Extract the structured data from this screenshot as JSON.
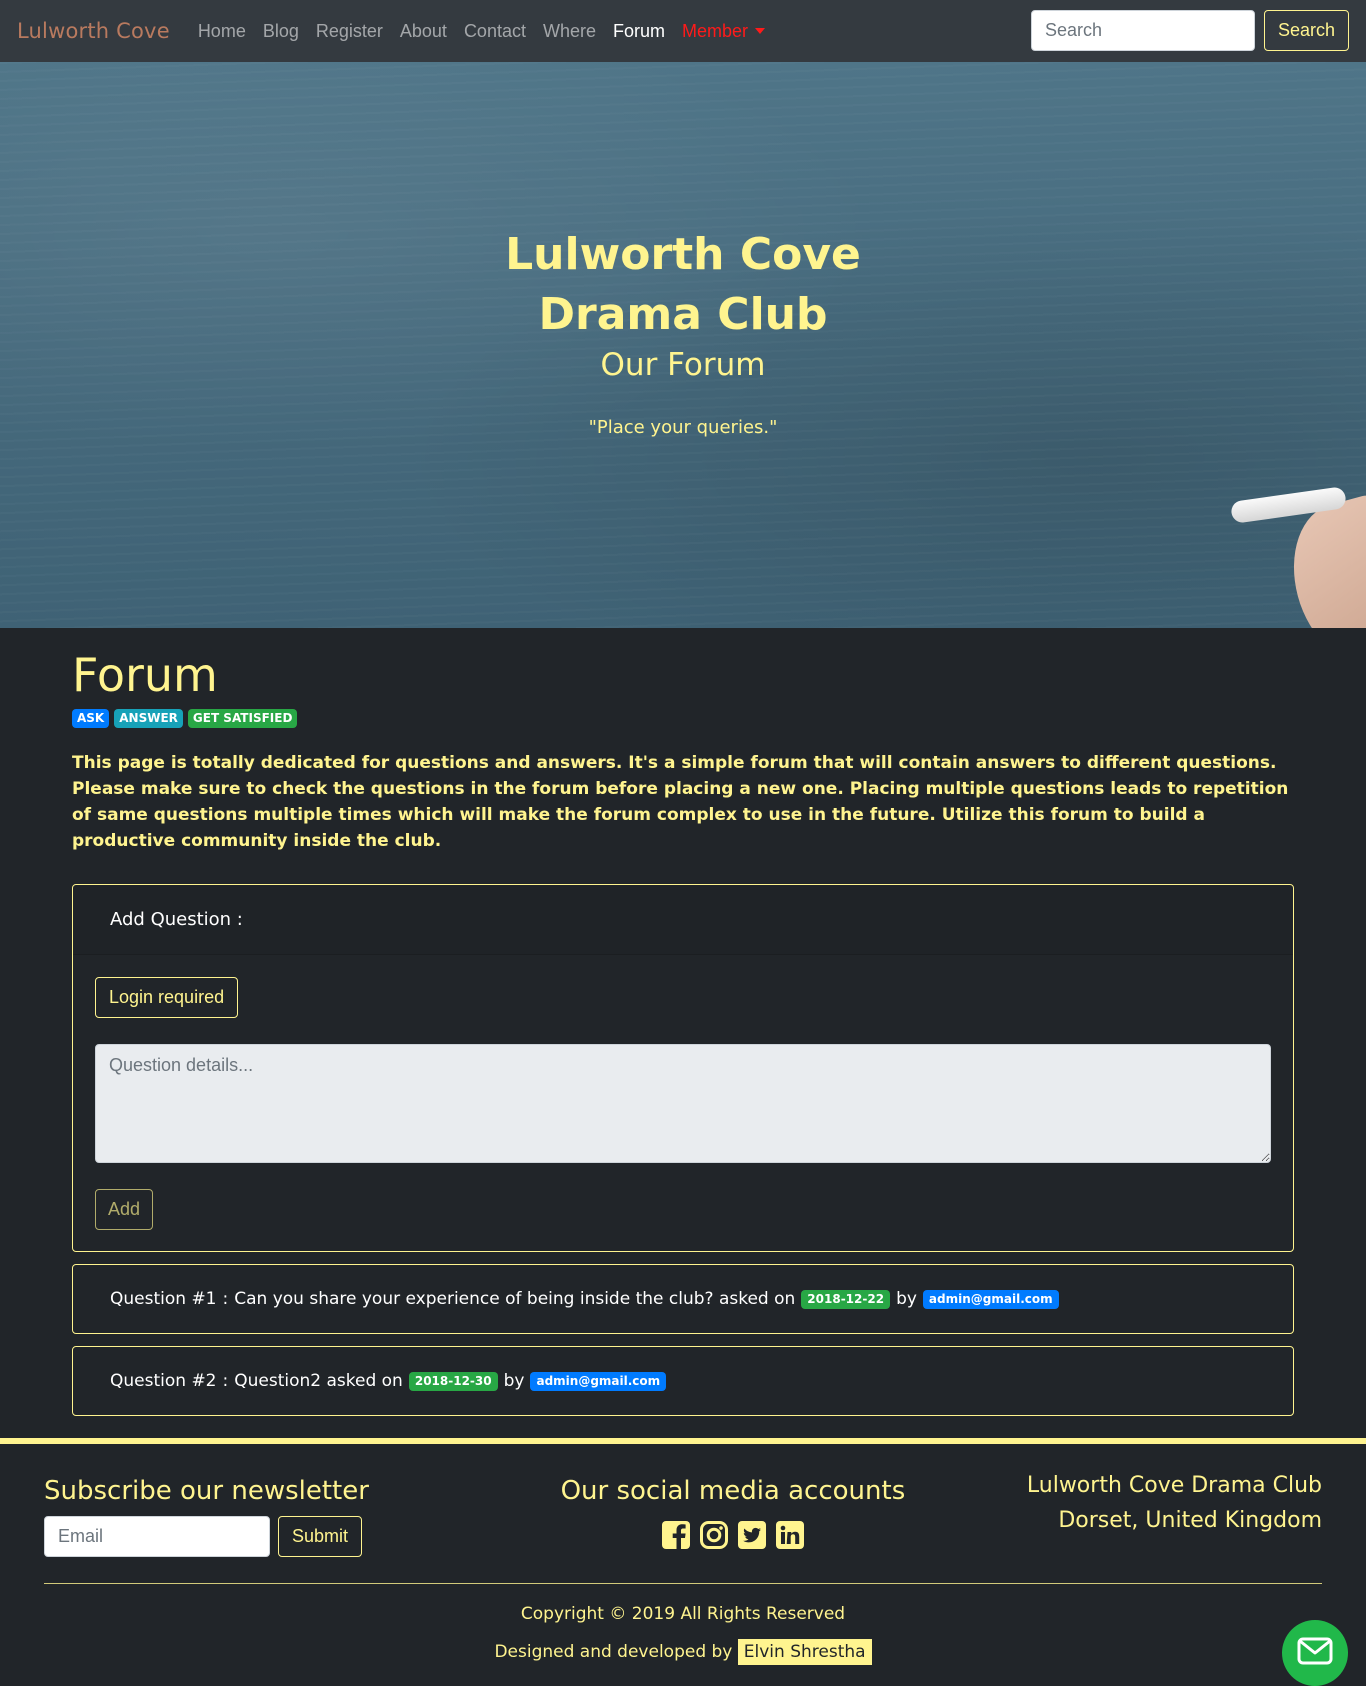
{
  "navbar": {
    "brand": "Lulworth Cove",
    "links": [
      "Home",
      "Blog",
      "Register",
      "About",
      "Contact",
      "Where",
      "Forum"
    ],
    "member": "Member",
    "search_placeholder": "Search",
    "search_button": "Search"
  },
  "hero": {
    "title_line1": "Lulworth Cove",
    "title_line2": "Drama Club",
    "subtitle": "Our Forum",
    "quote": "\"Place your queries.\""
  },
  "forum": {
    "title": "Forum",
    "badges": [
      "ASK",
      "ANSWER",
      "GET SATISFIED"
    ],
    "intro": "This page is totally dedicated for questions and answers. It's a simple forum that will contain answers to different questions. Please make sure to check the questions in the forum before placing a new one. Placing multiple questions leads to repetition of same questions multiple times which will make the forum complex to use in the future. Utilize this forum to build a productive community inside the club.",
    "add_card": {
      "header": "Add Question :",
      "login_button": "Login required",
      "textarea_placeholder": "Question details...",
      "add_button": "Add"
    },
    "questions": [
      {
        "label": "Question #1",
        "colon": ":",
        "text": "Can you share your experience of being inside the club? asked on",
        "date": "2018-12-22",
        "by": "by",
        "author": "admin@gmail.com"
      },
      {
        "label": "Question #2",
        "colon": ":",
        "text": "Question2 asked on",
        "date": "2018-12-30",
        "by": "by",
        "author": "admin@gmail.com"
      }
    ]
  },
  "footer": {
    "newsletter_title": "Subscribe our newsletter",
    "email_placeholder": "Email",
    "submit_button": "Submit",
    "social_title": "Our social media accounts",
    "social_icons": [
      "facebook-icon",
      "instagram-icon",
      "twitter-icon",
      "linkedin-icon"
    ],
    "address_line1": "Lulworth Cove Drama Club",
    "address_line2": "Dorset, United Kingdom",
    "copyright": "Copyright © 2019 All Rights Reserved",
    "credits_prefix": "Designed and developed by",
    "author": "Elvin Shrestha"
  },
  "colors": {
    "accent": "#fff48f",
    "background": "#212529",
    "navbar": "#343a40",
    "member": "#ff1a1a",
    "badge_blue": "#007bff",
    "badge_teal": "#17a2b8",
    "badge_green": "#28a745",
    "fab": "#21b84a"
  }
}
